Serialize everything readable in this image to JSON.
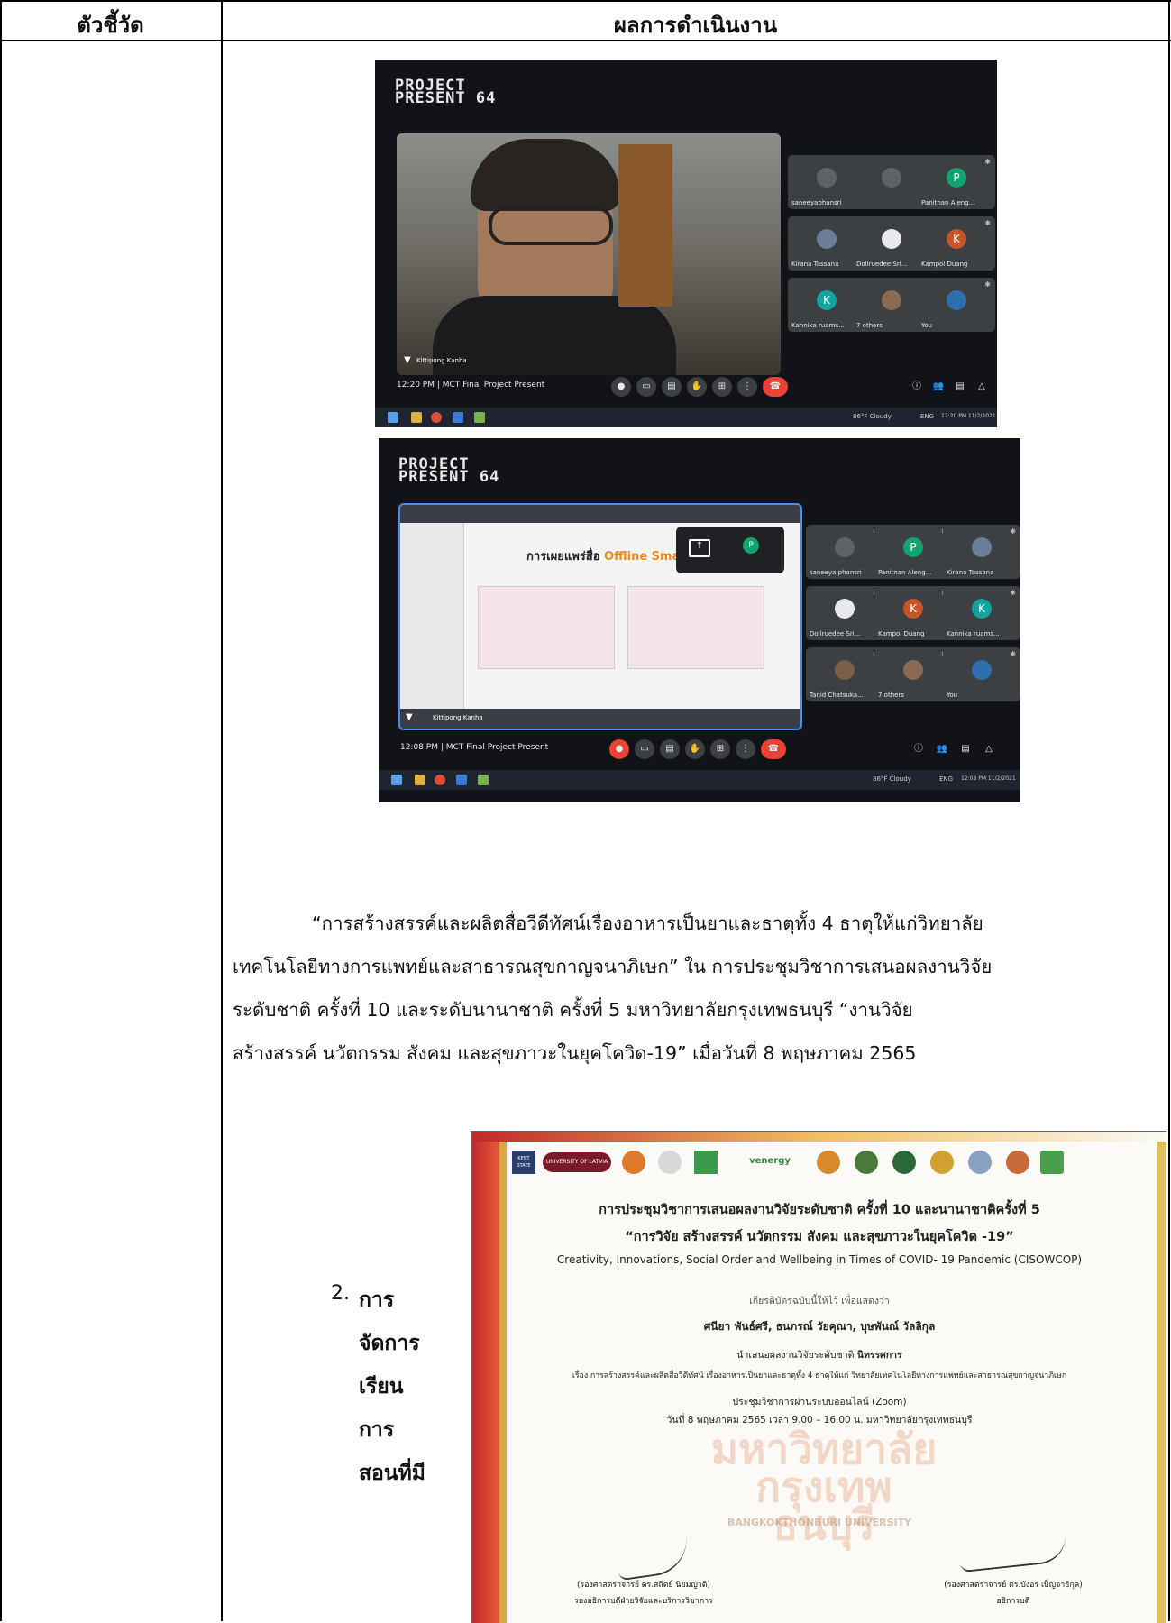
{
  "table": {
    "col1_header": "ตัวชี้วัด",
    "col2_header": "ผลการดำเนินงาน"
  },
  "screenshot1": {
    "banner": "PROJECT\nPRESENT 64",
    "presenter_name": "Kittipong Kanha",
    "meeting": "12:20 PM  |  MCT Final Project Present",
    "participants": [
      {
        "name": "saneeyaphansri",
        "avatar": "",
        "color": "#5f6368"
      },
      {
        "name": "",
        "avatar": "",
        "color": "#5f6368"
      },
      {
        "name": "Panitnan Aleng...",
        "avatar": "P",
        "color": "#12a46f"
      },
      {
        "name": "Kirana Tassana",
        "avatar": "",
        "color": "#6a7d99"
      },
      {
        "name": "Dollruedee Sri...",
        "avatar": "",
        "color": "#e8eaed"
      },
      {
        "name": "Kampol Duang",
        "avatar": "K",
        "color": "#c8552a"
      },
      {
        "name": "Kannika ruams...",
        "avatar": "K",
        "color": "#12a5a0"
      },
      {
        "name": "7 others",
        "avatar": "",
        "color": "#8a6a50"
      },
      {
        "name": "You",
        "avatar": "",
        "color": "#2f6fb0"
      }
    ],
    "weather": "86°F Cloudy",
    "lang": "ENG",
    "clock": "12:20 PM 11/2/2021"
  },
  "screenshot2": {
    "banner": "PROJECT\nPRESENT 64",
    "slide_title": "การเผยแพร่สื่อ",
    "slide_title_accent": "Offline Sma",
    "presenter_name": "Kittipong Kanha",
    "meeting": "12:08 PM  |  MCT Final Project Present",
    "participants": [
      {
        "name": "saneeya phansri",
        "avatar": "",
        "color": "#5f6368"
      },
      {
        "name": "Panitnan Aleng...",
        "avatar": "P",
        "color": "#12a46f"
      },
      {
        "name": "Kirana Tassana",
        "avatar": "",
        "color": "#6a7d99"
      },
      {
        "name": "Dollruedee Sri...",
        "avatar": "",
        "color": "#e8eaed"
      },
      {
        "name": "Kampol Duang",
        "avatar": "K",
        "color": "#c8552a"
      },
      {
        "name": "Kannika ruams...",
        "avatar": "K",
        "color": "#12a5a0"
      },
      {
        "name": "Tanid Chatsuka...",
        "avatar": "",
        "color": "#7a6048"
      },
      {
        "name": "7 others",
        "avatar": "",
        "color": "#8a6a50"
      },
      {
        "name": "You",
        "avatar": "",
        "color": "#2f6fb0"
      }
    ],
    "weather": "86°F Cloudy",
    "lang": "ENG",
    "clock": "12:08 PM 11/2/2021"
  },
  "paragraph": {
    "line1": "“การสร้างสรรค์และผลิตสื่อวีดีทัศน์เรื่องอาหารเป็นยาและธาตุทั้ง 4 ธาตุให้แก่วิทยาลัย",
    "line2": "เทคโนโลยีทางการแพทย์และสาธารณสุขกาญจนาภิเษก” ใน การประชุมวิชาการเสนอผลงานวิจัย",
    "line3": "ระดับชาติ ครั้งที่ 10 และระดับนานาชาติ ครั้งที่ 5 มหาวิทยาลัยกรุงเทพธนบุรี “งานวิจัย",
    "line4": "สร้างสรรค์ นวัตกรรม สังคม และสุขภาวะในยุคโควิด-19” เมื่อวันที่ 8 พฤษภาคม 2565"
  },
  "item": {
    "number": "2.",
    "lines": [
      "การ",
      "จัดการ",
      "เรียน",
      "การ",
      "สอนที่มี"
    ]
  },
  "certificate": {
    "logo_kent": "KENT STATE",
    "logo_latvia": "UNIVERSITY OF LATVIA",
    "logo_energy": "venergy",
    "title_th": "การประชุมวิชาการเสนอผลงานวิจัยระดับชาติ ครั้งที่ 10 และนานาชาติครั้งที่ 5",
    "theme_th": "“การวิจัย สร้างสรรค์ นวัตกรรม สังคม และสุขภาวะในยุคโควิด -19”",
    "title_en": "Creativity, Innovations, Social Order and Wellbeing in Times of COVID- 19 Pandemic (CISOWCOP)",
    "certify": "เกียรติบัตรฉบับนี้ให้ไว้ เพื่อแสดงว่า",
    "names": "ศนียา  พันธ์ศรี, ธนภรณ์  วัยคุณา, บุษพันณ์  วัลลิกุล",
    "presented": "นำเสนอผลงานวิจัยระดับชาติ",
    "presented_type": "นิทรรศการ",
    "topic": "เรื่อง การสร้างสรรค์และผลิตสื่อวีดีทัศน์ เรื่องอาหารเป็นยาและธาตุทั้ง 4 ธาตุให้แก่ วิทยาลัยเทคโนโลยีทางการแพทย์และสาธารณสุขกาญจนาภิเษก",
    "online": "ประชุมวิชาการผ่านระบบออนไลน์ (Zoom)",
    "date": "วันที่ 8 พฤษภาคม 2565 เวลา 9.00 – 16.00 น. มหาวิทยาลัยกรุงเทพธนบุรี",
    "watermark_th": "มหาวิทยาลัย กรุงเทพธนบุรี",
    "watermark_en": "BANGKOKTHONBURI UNIVERSITY",
    "signer1_name": "(รองศาสตราจารย์ ดร.สถิตย์ นิยมญาติ)",
    "signer1_title": "รองอธิการบดีฝ่ายวิจัยและบริการวิชาการ",
    "signer2_name": "(รองศาสตราจารย์ ดร.บังอร เบ็ญจาธิกุล)",
    "signer2_title": "อธิการบดี"
  }
}
